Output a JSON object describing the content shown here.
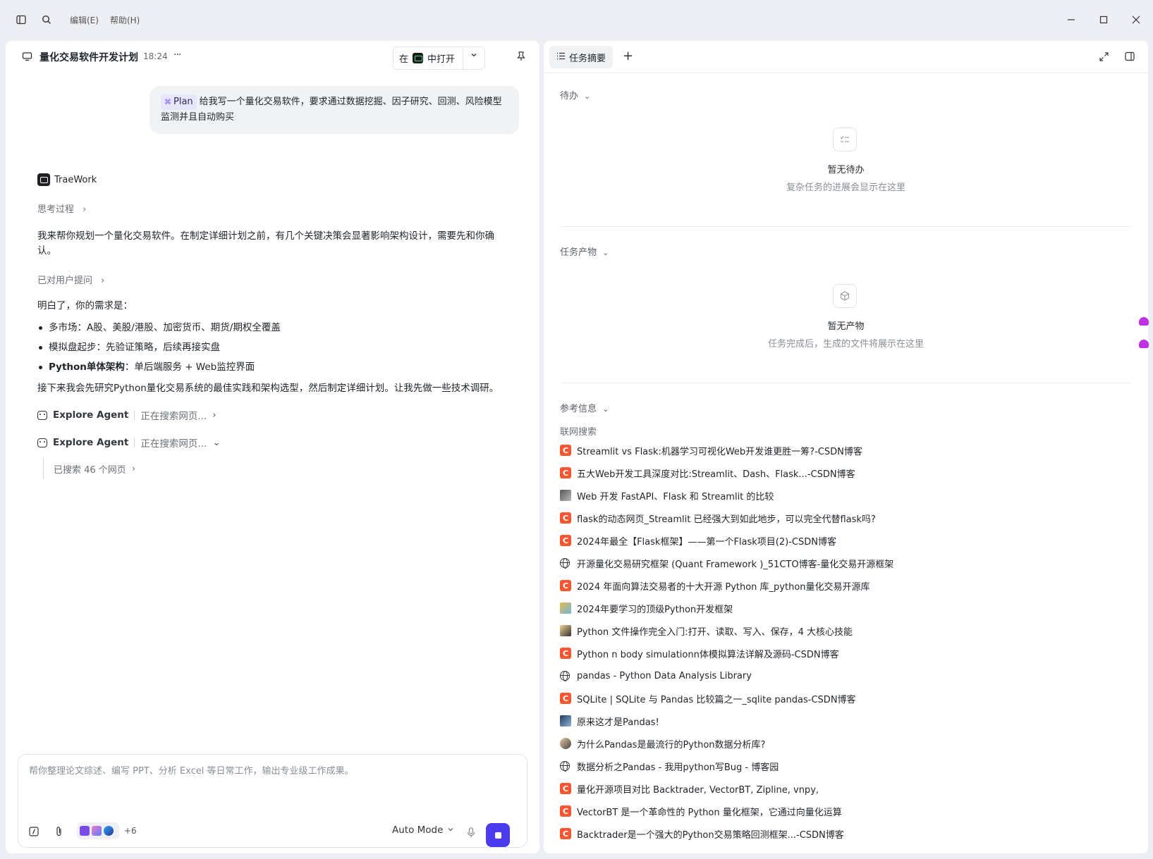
{
  "menu": {
    "edit": "编辑(E)",
    "help": "帮助(H)"
  },
  "chat": {
    "title": "量化交易软件开发计划",
    "time": "18:24",
    "more": "···",
    "open_in_prefix": "在",
    "open_in_suffix": "中打开"
  },
  "user_message": {
    "tag": "Plan",
    "text": "给我写一个量化交易软件，要求通过数据挖掘、因子研究、回测、风险模型监测并且自动购买"
  },
  "assistant": {
    "name": "TraeWork",
    "thinking_label": "思考过程",
    "intro": "我来帮你规划一个量化交易软件。在制定详细计划之前，有几个关键决策会显著影响架构设计，需要先和你确认。",
    "asked_label": "已对用户提问",
    "understood": "明白了，你的需求是：",
    "requirements": [
      {
        "bold": "",
        "text": "多市场：A股、美股/港股、加密货币、期货/期权全覆盖"
      },
      {
        "bold": "",
        "text": "模拟盘起步：先验证策略，后续再接实盘"
      },
      {
        "bold": "Python单体架构",
        "text": "：单后端服务 + Web监控界面"
      }
    ],
    "next": "接下来我会先研究Python量化交易系统的最佳实践和架构选型，然后制定详细计划。让我先做一些技术调研。",
    "agents": [
      {
        "name": "Explore Agent",
        "status": "正在搜索网页...",
        "chevron": "›"
      },
      {
        "name": "Explore Agent",
        "status": "正在搜索网页...",
        "chevron": "⌄"
      }
    ],
    "searched": "已搜索 46 个网页"
  },
  "composer": {
    "placeholder": "帮你整理论文综述、编写 PPT、分析 Excel 等日常工作，输出专业级工作成果。",
    "extra_count": "+6",
    "mode": "Auto Mode"
  },
  "right": {
    "tab_label": "任务摘要",
    "todo_title": "待办",
    "todo_empty_title": "暂无待办",
    "todo_empty_desc": "复杂任务的进展会显示在这里",
    "artifacts_title": "任务产物",
    "artifacts_empty_title": "暂无产物",
    "artifacts_empty_desc": "任务完成后，生成的文件将展示在这里",
    "refs_title": "参考信息",
    "web_search_label": "联网搜索",
    "refs": [
      {
        "icon": "csdn",
        "title": "Streamlit vs Flask:机器学习可视化Web开发谁更胜一筹?-CSDN博客"
      },
      {
        "icon": "csdn",
        "title": "五大Web开发工具深度对比:Streamlit、Dash、Flask...-CSDN博客"
      },
      {
        "icon": "img1",
        "title": "Web 开发 FastAPI、Flask 和 Streamlit 的比较"
      },
      {
        "icon": "csdn",
        "title": "flask的动态网页_Streamlit 已经强大到如此地步，可以完全代替flask吗?"
      },
      {
        "icon": "csdn",
        "title": "2024年最全【Flask框架】——第一个Flask项目(2)-CSDN博客"
      },
      {
        "icon": "globe",
        "title": "开源量化交易研究框架 (Quant Framework )_51CTO博客-量化交易开源框架"
      },
      {
        "icon": "csdn",
        "title": "2024 年面向算法交易者的十大开源 Python 库_python量化交易开源库"
      },
      {
        "icon": "img2",
        "title": "2024年要学习的顶级Python开发框架"
      },
      {
        "icon": "img3",
        "title": "Python 文件操作完全入门:打开、读取、写入、保存，4 大核心技能"
      },
      {
        "icon": "csdn",
        "title": "Python n body simulationn体模拟算法详解及源码-CSDN博客"
      },
      {
        "icon": "globe",
        "title": "pandas - Python Data Analysis Library"
      },
      {
        "icon": "csdn",
        "title": "SQLite | SQLite 与 Pandas 比较篇之一_sqlite pandas-CSDN博客"
      },
      {
        "icon": "img4",
        "title": "原来这才是Pandas!"
      },
      {
        "icon": "img5",
        "title": "为什么Pandas是最流行的Python数据分析库?"
      },
      {
        "icon": "globe",
        "title": "数据分析之Pandas - 我用python写Bug - 博客园"
      },
      {
        "icon": "csdn",
        "title": "量化开源项目对比 Backtrader, VectorBT, Zipline, vnpy,"
      },
      {
        "icon": "csdn",
        "title": "VectorBT 是一个革命性的 Python 量化框架，它通过向量化运算"
      },
      {
        "icon": "csdn",
        "title": "Backtrader是一个强大的Python交易策略回测框架...-CSDN博客"
      }
    ]
  },
  "colors": {
    "accent": "#4b3cf0",
    "csdn": "#fc5531",
    "plan_tag_bg": "#e8e6fb"
  }
}
